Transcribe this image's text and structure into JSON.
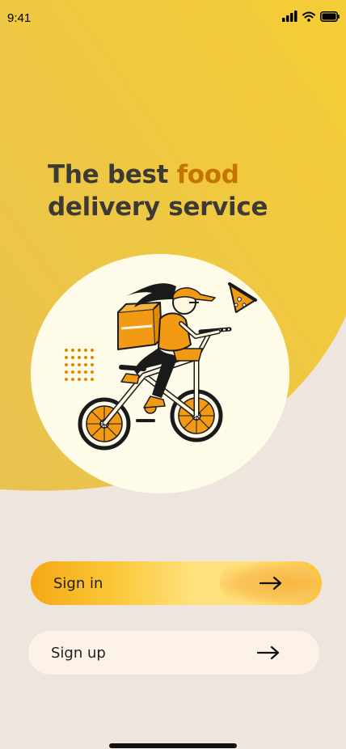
{
  "status_bar": {
    "time": "9:41"
  },
  "hero": {
    "headline_part1": "The best ",
    "headline_accent": "food",
    "headline_part2": "delivery service"
  },
  "buttons": {
    "sign_in_label": "Sign in",
    "sign_up_label": "Sign up"
  },
  "colors": {
    "background": "#efe5df",
    "accent_text": "#c47500",
    "yellow_top": "#f2c94c",
    "brand_orange": "#f5a814"
  },
  "icons": {
    "signal": "cellular-signal-icon",
    "wifi": "wifi-icon",
    "battery": "battery-icon",
    "arrow": "arrow-right-icon"
  }
}
